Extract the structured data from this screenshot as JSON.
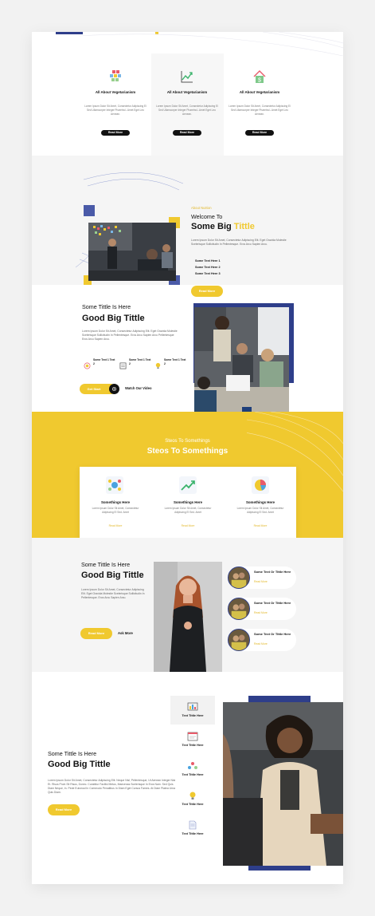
{
  "colors": {
    "accent": "#f0c92f",
    "navy": "#2e3e8a",
    "dark": "#111111"
  },
  "features": [
    {
      "icon": "blocks-icon",
      "title": "All About Vegetarianism",
      "desc": "Lorem Ipsum Dolor Sit Amet, Consectetur Adipiscing El Sed Ullamcorper Integer Pharetra L Amet Eget Leo Aenean.",
      "button": "Read More"
    },
    {
      "icon": "growth-chart-icon",
      "title": "All About Vegetarianism",
      "desc": "Lorem Ipsum Dolor Sit Amet, Consectetur Adipiscing El Sed Ullamcorper Integer Pharetra L Amet Eget Leo Aenean.",
      "button": "Read More"
    },
    {
      "icon": "house-money-icon",
      "title": "All About Vegetarianism",
      "desc": "Lorem Ipsum Dolor Sit Amet, Consectetur Adipiscing El Sed Ullamcorper Integer Pharetra L Amet Eget Leo Aenean.",
      "button": "Read More"
    }
  ],
  "about": {
    "eyebrow": "About Nutrion",
    "welcome": "Welcome To",
    "title_main": "Some Big",
    "title_accent": "Tittle",
    "desc": "Lorem Ipsum Dolor Sit Amet, Consectetur Adipiscing Elit. Eget Gravida Molestie Scelerisque Sollicitudin In Pellentesque. Eros Arcu Sapien Arcu.",
    "list": [
      "Some Text Here 1",
      "Some Text Here 2",
      "Some Text Here 3"
    ],
    "button": "Read More"
  },
  "good1": {
    "subtitle": "Some Tittle Is Here",
    "title": "Good Big Tittle",
    "desc": "Lorem Ipsum Dolor Sit Amet, Consectetur Adipiscing Elit. Eget Gravida Molestie Scelerisque Sollicitudin In Pellentesque. Eros Arcu Sapien Arcu Pellentesque Eros Arcu Sapien Arcu.",
    "items": [
      {
        "icon": "target-icon",
        "label": "Some Text 1 Text 2"
      },
      {
        "icon": "document-icon",
        "label": "Some Text 1 Text 2"
      },
      {
        "icon": "bulb-icon",
        "label": "Some Text 1 Text 2"
      }
    ],
    "button": "Get Start",
    "video": "Watch Our Video"
  },
  "steps": {
    "subtitle": "Steos To Somethings",
    "title": "Steos To Somethings",
    "cards": [
      {
        "icon": "people-network-icon",
        "title": "Somethings Here",
        "desc": "Lorem Ipsum Dolor Sit Amet, Consectetur Adipiscing El Sed. Amet",
        "link": "Read More"
      },
      {
        "icon": "trend-chart-icon",
        "title": "Somethings Here",
        "desc": "Lorem Ipsum Dolor Sit Amet, Consectetur Adipiscing El Sed. Amet",
        "link": "Read More"
      },
      {
        "icon": "pie-chart-icon",
        "title": "Somethings Here",
        "desc": "Lorem Ipsum Dolor Sit Amet, Consectetur Adipiscing El Sed. Amet",
        "link": "Read More"
      }
    ]
  },
  "good2": {
    "subtitle": "Some Tittle Is Here",
    "title": "Good Big Tittle",
    "desc": "Lorem Ipsum Dolor Sit Amet, Consectetur Adipiscing Elit. Eget Gravida Molestie Scelerisque Sollicitudin In Pellentesque. Eros Arcu Sapien Arcu.",
    "button": "Read More",
    "ask": "Ask More",
    "cards": [
      {
        "title": "Some Text Or Tittle Here",
        "link": "Read More"
      },
      {
        "title": "Some Text Or Tittle Here",
        "link": "Read More"
      },
      {
        "title": "Some Text Or Tittle Here",
        "link": "Read More"
      }
    ]
  },
  "good3": {
    "subtitle": "Some Tittle Is Here",
    "title": "Good Big Tittle",
    "desc": "Lorem Ipsum Dolor Sit Amet, Consectetur Adipiscing Elit. Neque Nisl, Pellentesque, Ut Aenean Integer Nisi Et. Risus Proin Sit Risus, Donec. Curabitur Facilisi Metus, Maecenas Scelerisque In Eros Nam. Sed Quis Diam Neque, In. Pede Euismod In Commodo Penatibus In Diam Eget Cursus Fames. At Diam Platea Urna Quis Diam.",
    "button": "Read More",
    "tabs": [
      {
        "icon": "dashboard-icon",
        "label": "Text Tittle Here"
      },
      {
        "icon": "browser-icon",
        "label": "Text Tittle Here"
      },
      {
        "icon": "team-icon",
        "label": "Text Tittle Here"
      },
      {
        "icon": "idea-icon",
        "label": "Text Tittle Here"
      },
      {
        "icon": "file-icon",
        "label": "Text Tittle Here"
      }
    ]
  }
}
